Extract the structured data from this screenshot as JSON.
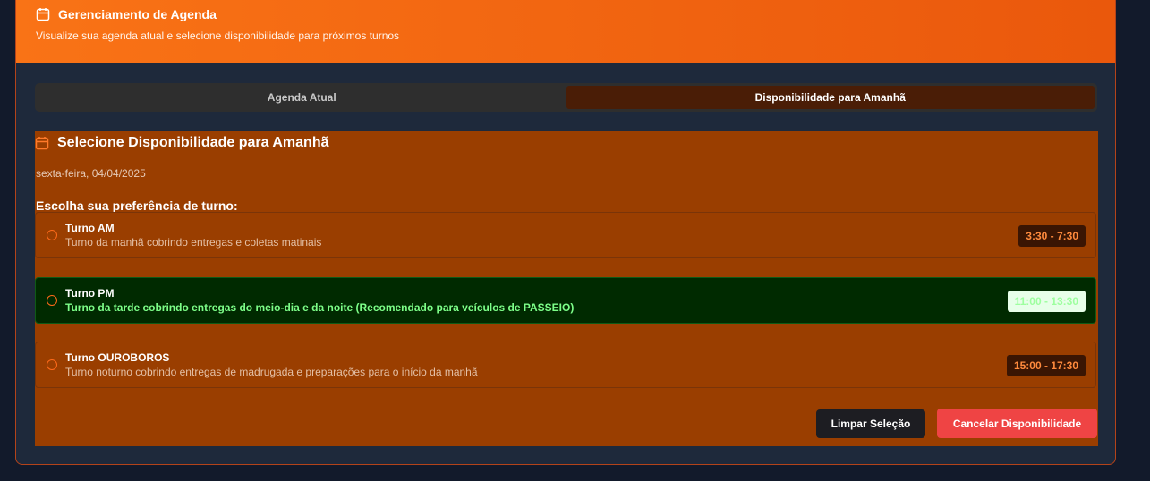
{
  "header": {
    "title": "Gerenciamento de Agenda",
    "subtitle": "Visualize sua agenda atual e selecione disponibilidade para próximos turnos",
    "icon": "calendar-icon"
  },
  "tabs": [
    {
      "label": "Agenda Atual",
      "active": false
    },
    {
      "label": "Disponibilidade para Amanhã",
      "active": true
    }
  ],
  "panel": {
    "title": "Selecione Disponibilidade para Amanhã",
    "date": "sexta-feira, 04/04/2025",
    "prompt": "Escolha sua preferência de turno:"
  },
  "shifts": [
    {
      "name": "Turno AM",
      "description": "Turno da manhã cobrindo entregas e coletas matinais",
      "time": "3:30 - 7:30",
      "highlighted": false
    },
    {
      "name": "Turno PM",
      "description": "Turno da tarde cobrindo entregas do meio-dia e da noite (Recomendado para veículos de PASSEIO)",
      "time": "11:00 - 13:30",
      "highlighted": true
    },
    {
      "name": "Turno OUROBOROS",
      "description": "Turno noturno cobrindo entregas de madrugada e preparações para o início da manhã",
      "time": "15:00 - 17:30",
      "highlighted": false
    }
  ],
  "actions": {
    "clear_label": "Limpar Seleção",
    "cancel_label": "Cancelar Disponibilidade"
  },
  "colors": {
    "accent": "#f97316",
    "panel": "#9a3e00",
    "highlight": "#002a00",
    "danger": "#ef4444"
  }
}
